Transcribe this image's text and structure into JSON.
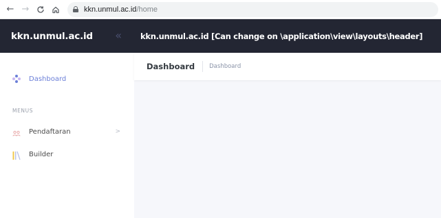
{
  "browser": {
    "back_icon": "arrow-left-icon",
    "forward_icon": "arrow-right-icon",
    "reload_icon": "reload-icon",
    "home_icon": "home-icon",
    "url_host": "kkn.unmul.ac.id",
    "url_path": "/home"
  },
  "header": {
    "brand": "kkn.unmul.ac.id",
    "collapse_symbol": "«",
    "title": "kkn.unmul.ac.id [Can change on \\application\\view\\layouts\\header]"
  },
  "sidebar": {
    "dashboard_label": "Dashboard",
    "section_label": "MENUS",
    "items": [
      {
        "label": "Pendaftaran",
        "has_submenu": true,
        "chevron": ">"
      },
      {
        "label": "Builder",
        "has_submenu": false
      }
    ]
  },
  "page": {
    "title": "Dashboard",
    "breadcrumb": "Dashboard"
  },
  "colors": {
    "header_bg": "#232633",
    "accent": "#6b7fd8",
    "content_bg": "#f6f7fb"
  }
}
